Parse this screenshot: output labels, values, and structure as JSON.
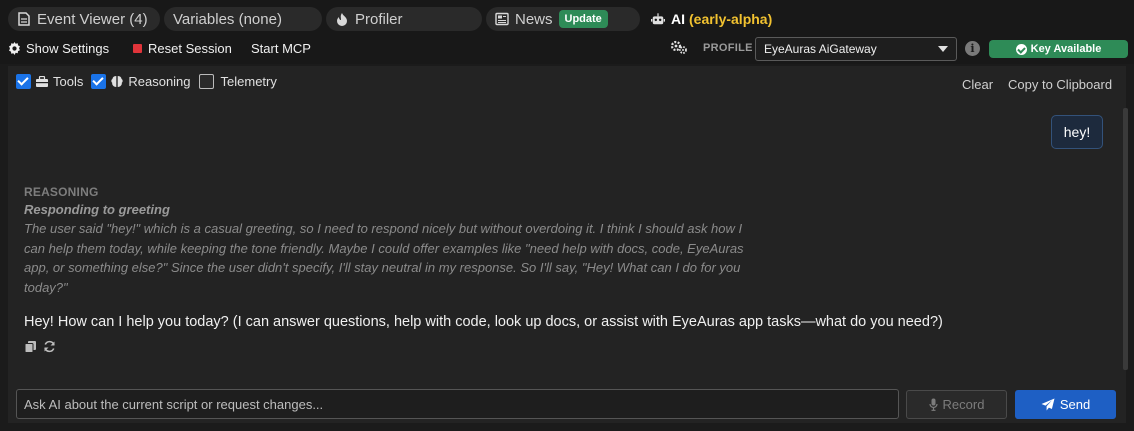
{
  "tabs": [
    {
      "label": "Event Viewer (4)",
      "icon": "document-icon"
    },
    {
      "label": "Variables (none)",
      "icon": ""
    },
    {
      "label": "Profiler",
      "icon": "fire-icon"
    },
    {
      "label": "News",
      "icon": "newspaper-icon",
      "badge": "Update"
    },
    {
      "label": "AI",
      "accent": "(early-alpha)",
      "icon": "robot-icon"
    }
  ],
  "toolbar": {
    "show_settings": "Show Settings",
    "reset_session": "Reset Session",
    "start_mcp": "Start MCP",
    "profile_label": "PROFILE",
    "profile_value": "EyeAuras AiGateway",
    "key_status": "Key Available"
  },
  "filters": {
    "tools": {
      "label": "Tools",
      "checked": true
    },
    "reasoning": {
      "label": "Reasoning",
      "checked": true
    },
    "telemetry": {
      "label": "Telemetry",
      "checked": false
    },
    "clear": "Clear",
    "copy": "Copy to Clipboard"
  },
  "conversation": {
    "user_message": "hey!",
    "reasoning_header": "REASONING",
    "reasoning_title": "Responding to greeting",
    "reasoning_lines": [
      "The user said \"hey!\" which is a casual greeting, so I need to respond nicely but without overdoing it. I think I should ask how I",
      "can help them today, while keeping the tone friendly. Maybe I could offer examples like \"need help with docs, code, EyeAuras",
      "app, or something else?\" Since the user didn't specify, I'll stay neutral in my response. So I'll say, \"Hey! What can I do for you",
      "today?\""
    ],
    "assistant_message": "Hey! How can I help you today? (I can answer questions, help with code, look up docs, or assist with EyeAuras app tasks—what do you need?)"
  },
  "input": {
    "placeholder": "Ask AI about the current script or request changes...",
    "record_label": "Record",
    "send_label": "Send"
  },
  "colors": {
    "accent_yellow": "#f2c230",
    "update_green": "#2e8b57",
    "send_blue": "#1e5fc4",
    "reset_red": "#e0343a"
  }
}
